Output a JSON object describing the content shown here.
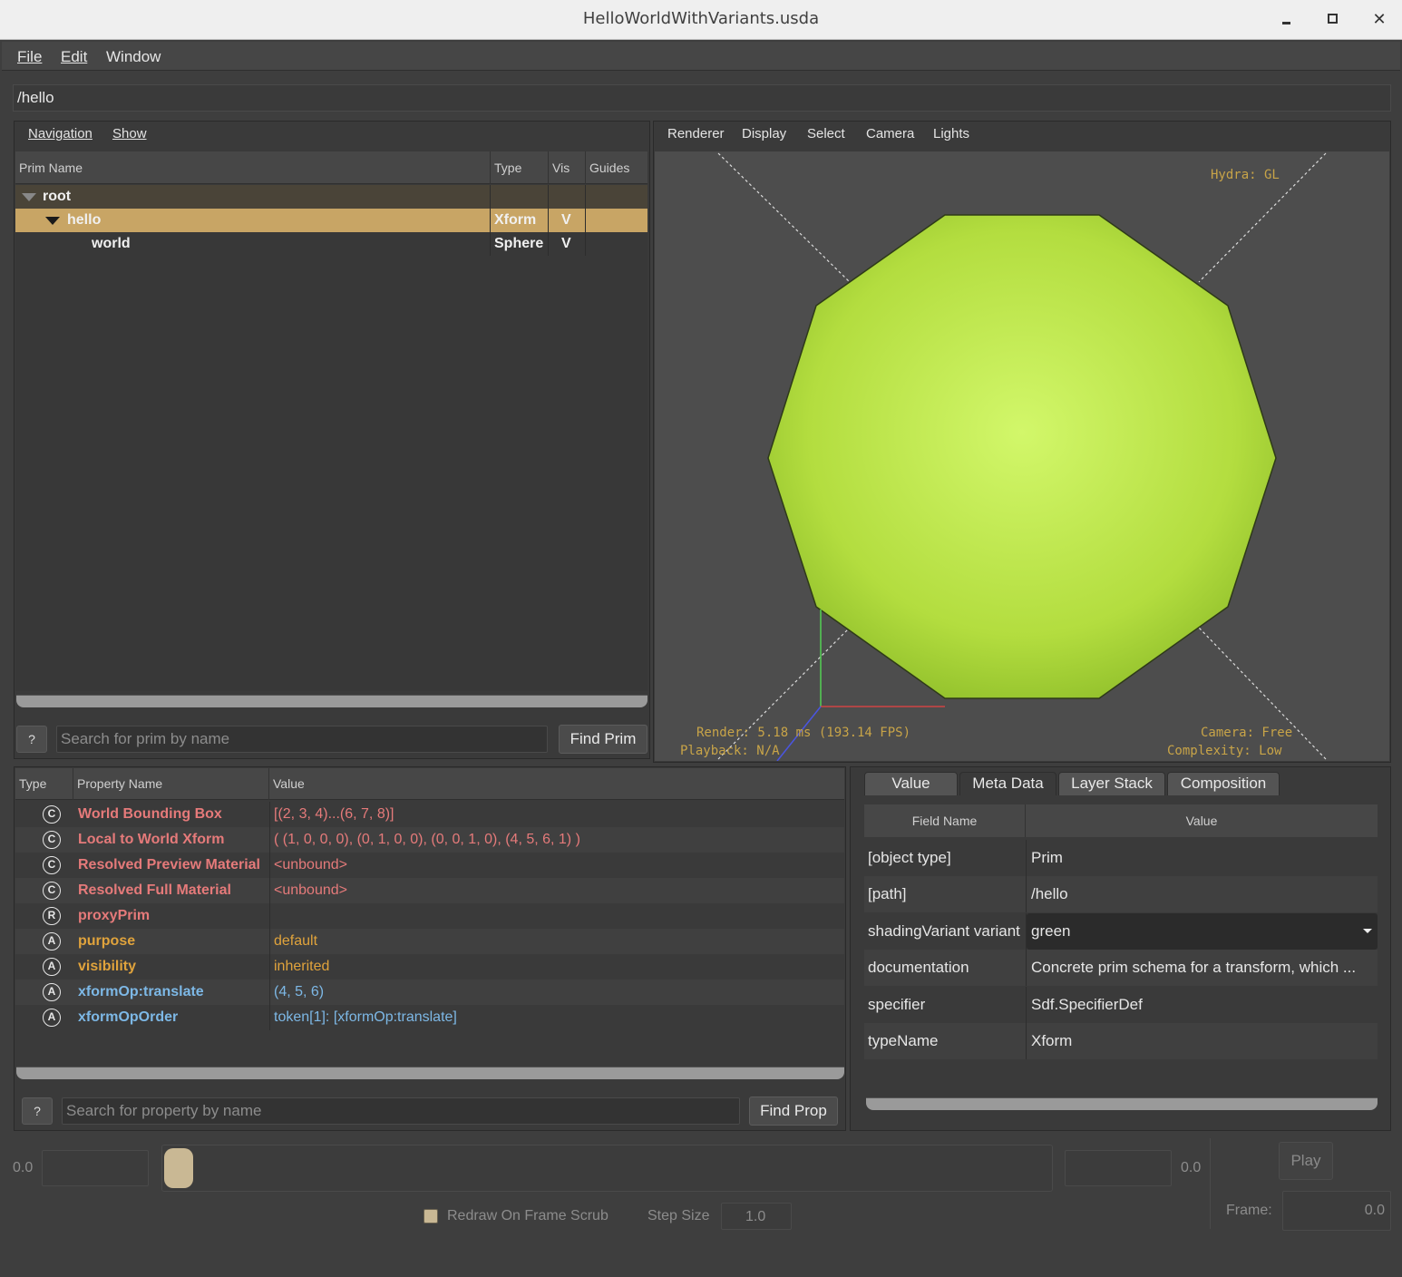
{
  "window": {
    "title": "HelloWorldWithVariants.usda"
  },
  "menu": {
    "file": "File",
    "edit": "Edit",
    "window": "Window"
  },
  "path": "/hello",
  "tree_panel": {
    "menu": {
      "navigation": "Navigation",
      "show": "Show"
    },
    "columns": [
      "Prim Name",
      "Type",
      "Vis",
      "Guides"
    ],
    "rows": [
      {
        "name": "root",
        "type": "",
        "vis": "",
        "guides": ""
      },
      {
        "name": "hello",
        "type": "Xform",
        "vis": "V",
        "guides": ""
      },
      {
        "name": "world",
        "type": "Sphere",
        "vis": "V",
        "guides": ""
      }
    ],
    "help_label": "?",
    "search_placeholder": "Search for prim by name",
    "find_label": "Find Prim"
  },
  "viewport": {
    "menu": {
      "renderer": "Renderer",
      "display": "Display",
      "select": "Select",
      "camera": "Camera",
      "lights": "Lights"
    },
    "hud": {
      "hydra": "Hydra: GL",
      "render": "Render: 5.18 ms (193.14 FPS)",
      "playback": "Playback: N/A",
      "camera": "Camera: Free",
      "complexity": "Complexity: Low"
    },
    "colors": {
      "sphere": "#b8e040",
      "background": "#4d4d4d"
    }
  },
  "properties": {
    "columns": [
      "Type",
      "Property Name",
      "Value"
    ],
    "rows": [
      {
        "icon": "C",
        "name": "World Bounding Box",
        "value": "[(2, 3, 4)...(6, 7, 8)]",
        "color": "#e57a7a"
      },
      {
        "icon": "C",
        "name": "Local to World Xform",
        "value": "( (1, 0, 0, 0), (0, 1, 0, 0), (0, 0, 1, 0), (4, 5, 6, 1) )",
        "color": "#e57a7a"
      },
      {
        "icon": "C",
        "name": "Resolved Preview Material",
        "value": "<unbound>",
        "color": "#e57a7a"
      },
      {
        "icon": "C",
        "name": "Resolved Full Material",
        "value": "<unbound>",
        "color": "#e57a7a"
      },
      {
        "icon": "R",
        "name": "proxyPrim",
        "value": "",
        "color": "#e57a7a"
      },
      {
        "icon": "A",
        "name": "purpose",
        "value": "default",
        "color": "#e0a33c"
      },
      {
        "icon": "A",
        "name": "visibility",
        "value": "inherited",
        "color": "#e0a33c"
      },
      {
        "icon": "A",
        "name": "xformOp:translate",
        "value": "(4, 5, 6)",
        "color": "#7db8e6"
      },
      {
        "icon": "A",
        "name": "xformOpOrder",
        "value": "token[1]: [xformOp:translate]",
        "color": "#7db8e6"
      }
    ],
    "help_label": "?",
    "search_placeholder": "Search for property by name",
    "find_label": "Find Prop"
  },
  "metadata": {
    "tabs": [
      "Value",
      "Meta Data",
      "Layer Stack",
      "Composition"
    ],
    "active_tab": "Meta Data",
    "columns": [
      "Field Name",
      "Value"
    ],
    "rows": [
      {
        "field": "[object type]",
        "value": "Prim"
      },
      {
        "field": "[path]",
        "value": "/hello"
      },
      {
        "field": "shadingVariant variant",
        "value": "green",
        "dropdown": true
      },
      {
        "field": "documentation",
        "value": "Concrete prim schema for a transform, which ..."
      },
      {
        "field": "specifier",
        "value": "Sdf.SpecifierDef"
      },
      {
        "field": "typeName",
        "value": "Xform"
      }
    ]
  },
  "timeline": {
    "start": "0.0",
    "end": "0.0",
    "play_label": "Play",
    "frame_label": "Frame:",
    "frame_value": "0.0",
    "redraw_label": "Redraw On Frame Scrub",
    "step_label": "Step Size",
    "step_value": "1.0"
  }
}
